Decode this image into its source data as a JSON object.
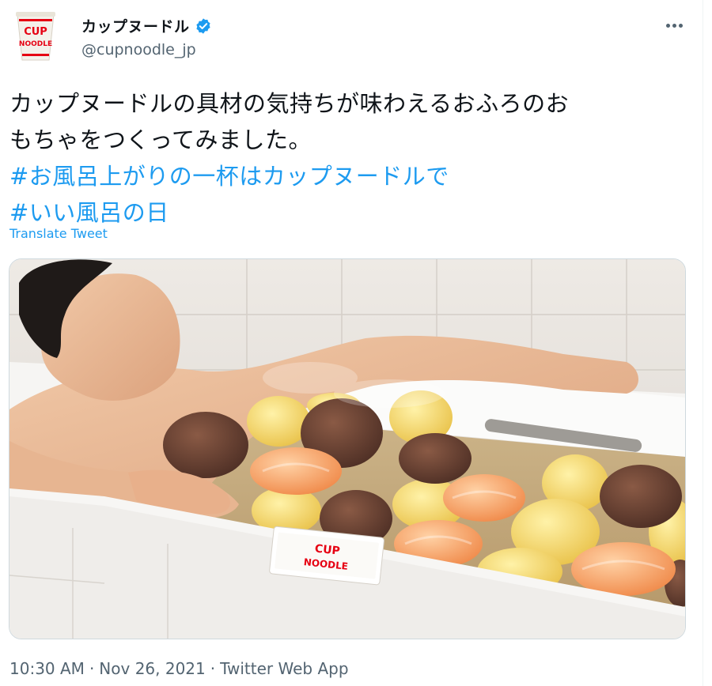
{
  "author": {
    "name": "カップヌードル",
    "handle": "@cupnoodle_jp",
    "verified": true,
    "avatar_text_top": "CUP",
    "avatar_text_bottom": "NOODLE"
  },
  "tweet": {
    "text_line1": "カップヌードルの具材の気持ちが味わえるおふろのお",
    "text_line2": "もちゃをつくってみました。",
    "hashtag1": "#お風呂上がりの一杯はカップヌードルで",
    "hashtag2": "#いい風呂の日",
    "translate_label": "Translate Tweet"
  },
  "media": {
    "icon": "photo",
    "package_text_top": "CUP",
    "package_text_bottom": "NOODLE"
  },
  "meta": {
    "time": "10:30 AM",
    "separator": "·",
    "date": "Nov 26, 2021",
    "source": "Twitter Web App"
  },
  "colors": {
    "link": "#1d9bf0",
    "secondary_text": "#536471",
    "brand_red": "#e60012"
  }
}
